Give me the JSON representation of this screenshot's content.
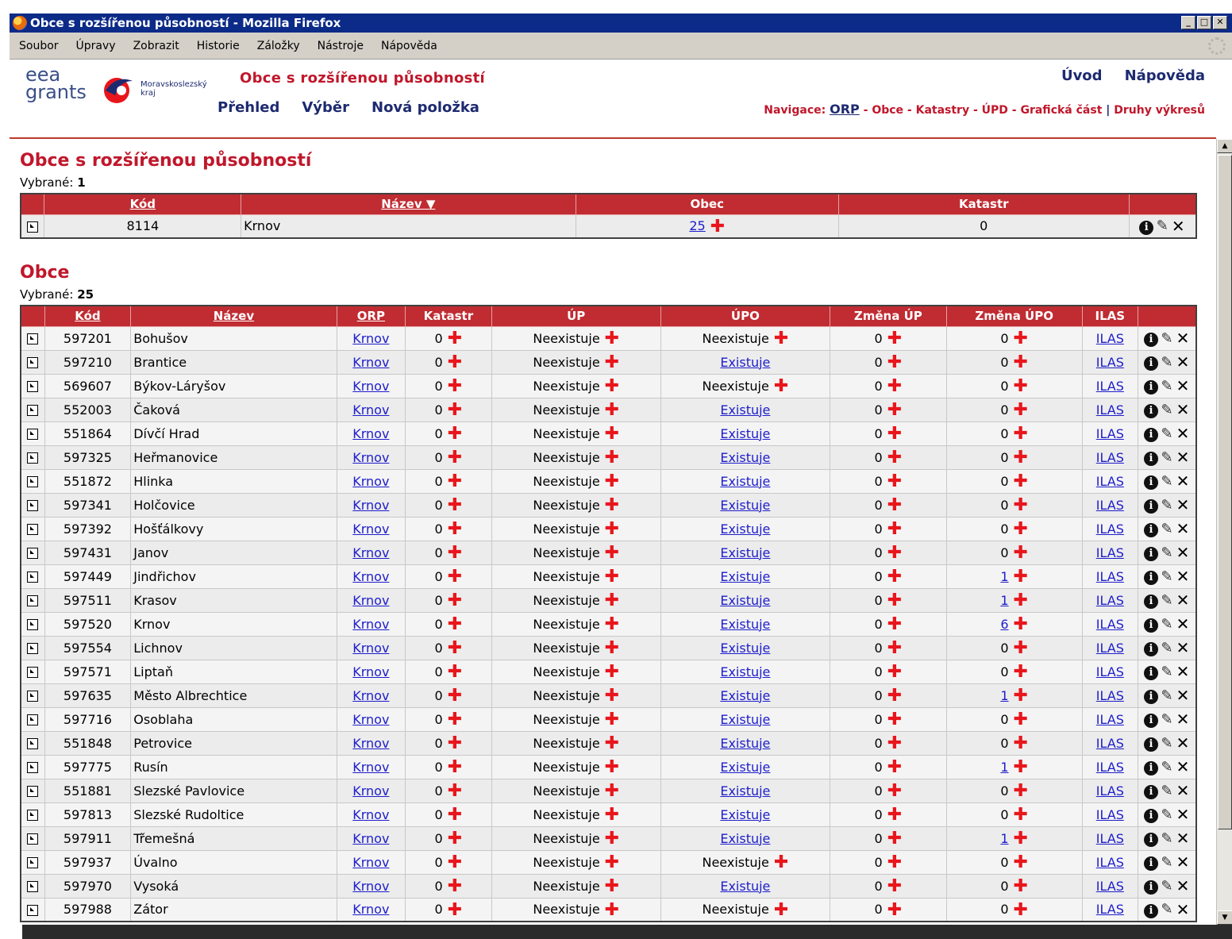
{
  "window": {
    "title": "Obce s rozšířenou působností - Mozilla Firefox"
  },
  "menu": [
    "Soubor",
    "Úpravy",
    "Zobrazit",
    "Historie",
    "Záložky",
    "Nástroje",
    "Nápověda"
  ],
  "header": {
    "logo_eea": "eea grants",
    "logo_msk": "Moravskoslezský kraj",
    "title": "Obce s rozšířenou působností",
    "nav": [
      "Přehled",
      "Výběr",
      "Nová položka"
    ],
    "links": [
      "Úvod",
      "Nápověda"
    ],
    "navigation_label": "Navigace:",
    "breadcrumb": [
      "ORP",
      "Obce",
      "Katastry",
      "ÚPD",
      "Grafická část",
      "Druhy výkresů"
    ]
  },
  "orp": {
    "heading": "Obce s rozšířenou působností",
    "selected_label": "Vybrané:",
    "selected_count": "1",
    "columns": [
      "Kód",
      "Název ▼",
      "Obec",
      "Katastr"
    ],
    "rows": [
      {
        "kod": "8114",
        "nazev": "Krnov",
        "obec": "25",
        "katastr": "0"
      }
    ]
  },
  "obce": {
    "heading": "Obce",
    "selected_label": "Vybrané:",
    "selected_count": "25",
    "columns": [
      "Kód",
      "Název",
      "ORP",
      "Katastr",
      "ÚP",
      "ÚPO",
      "Změna ÚP",
      "Změna ÚPO",
      "ILAS"
    ],
    "rows": [
      {
        "kod": "597201",
        "nazev": "Bohušov",
        "orp": "Krnov",
        "katastr": "0",
        "up": "Neexistuje",
        "upo": "Neexistuje",
        "upo_link": false,
        "zmena_up": "0",
        "zmena_upo": "0",
        "zmena_upo_link": false,
        "ilas": "ILAS"
      },
      {
        "kod": "597210",
        "nazev": "Brantice",
        "orp": "Krnov",
        "katastr": "0",
        "up": "Neexistuje",
        "upo": "Existuje",
        "upo_link": true,
        "zmena_up": "0",
        "zmena_upo": "0",
        "zmena_upo_link": false,
        "ilas": "ILAS"
      },
      {
        "kod": "569607",
        "nazev": "Býkov-Láryšov",
        "orp": "Krnov",
        "katastr": "0",
        "up": "Neexistuje",
        "upo": "Neexistuje",
        "upo_link": false,
        "zmena_up": "0",
        "zmena_upo": "0",
        "zmena_upo_link": false,
        "ilas": "ILAS"
      },
      {
        "kod": "552003",
        "nazev": "Čaková",
        "orp": "Krnov",
        "katastr": "0",
        "up": "Neexistuje",
        "upo": "Existuje",
        "upo_link": true,
        "zmena_up": "0",
        "zmena_upo": "0",
        "zmena_upo_link": false,
        "ilas": "ILAS"
      },
      {
        "kod": "551864",
        "nazev": "Dívčí Hrad",
        "orp": "Krnov",
        "katastr": "0",
        "up": "Neexistuje",
        "upo": "Existuje",
        "upo_link": true,
        "zmena_up": "0",
        "zmena_upo": "0",
        "zmena_upo_link": false,
        "ilas": "ILAS"
      },
      {
        "kod": "597325",
        "nazev": "Heřmanovice",
        "orp": "Krnov",
        "katastr": "0",
        "up": "Neexistuje",
        "upo": "Existuje",
        "upo_link": true,
        "zmena_up": "0",
        "zmena_upo": "0",
        "zmena_upo_link": false,
        "ilas": "ILAS"
      },
      {
        "kod": "551872",
        "nazev": "Hlinka",
        "orp": "Krnov",
        "katastr": "0",
        "up": "Neexistuje",
        "upo": "Existuje",
        "upo_link": true,
        "zmena_up": "0",
        "zmena_upo": "0",
        "zmena_upo_link": false,
        "ilas": "ILAS"
      },
      {
        "kod": "597341",
        "nazev": "Holčovice",
        "orp": "Krnov",
        "katastr": "0",
        "up": "Neexistuje",
        "upo": "Existuje",
        "upo_link": true,
        "zmena_up": "0",
        "zmena_upo": "0",
        "zmena_upo_link": false,
        "ilas": "ILAS"
      },
      {
        "kod": "597392",
        "nazev": "Hošťálkovy",
        "orp": "Krnov",
        "katastr": "0",
        "up": "Neexistuje",
        "upo": "Existuje",
        "upo_link": true,
        "zmena_up": "0",
        "zmena_upo": "0",
        "zmena_upo_link": false,
        "ilas": "ILAS"
      },
      {
        "kod": "597431",
        "nazev": "Janov",
        "orp": "Krnov",
        "katastr": "0",
        "up": "Neexistuje",
        "upo": "Existuje",
        "upo_link": true,
        "zmena_up": "0",
        "zmena_upo": "0",
        "zmena_upo_link": false,
        "ilas": "ILAS"
      },
      {
        "kod": "597449",
        "nazev": "Jindřichov",
        "orp": "Krnov",
        "katastr": "0",
        "up": "Neexistuje",
        "upo": "Existuje",
        "upo_link": true,
        "zmena_up": "0",
        "zmena_upo": "1",
        "zmena_upo_link": true,
        "ilas": "ILAS"
      },
      {
        "kod": "597511",
        "nazev": "Krasov",
        "orp": "Krnov",
        "katastr": "0",
        "up": "Neexistuje",
        "upo": "Existuje",
        "upo_link": true,
        "zmena_up": "0",
        "zmena_upo": "1",
        "zmena_upo_link": true,
        "ilas": "ILAS"
      },
      {
        "kod": "597520",
        "nazev": "Krnov",
        "orp": "Krnov",
        "katastr": "0",
        "up": "Neexistuje",
        "upo": "Existuje",
        "upo_link": true,
        "zmena_up": "0",
        "zmena_upo": "6",
        "zmena_upo_link": true,
        "ilas": "ILAS"
      },
      {
        "kod": "597554",
        "nazev": "Lichnov",
        "orp": "Krnov",
        "katastr": "0",
        "up": "Neexistuje",
        "upo": "Existuje",
        "upo_link": true,
        "zmena_up": "0",
        "zmena_upo": "0",
        "zmena_upo_link": false,
        "ilas": "ILAS"
      },
      {
        "kod": "597571",
        "nazev": "Liptaň",
        "orp": "Krnov",
        "katastr": "0",
        "up": "Neexistuje",
        "upo": "Existuje",
        "upo_link": true,
        "zmena_up": "0",
        "zmena_upo": "0",
        "zmena_upo_link": false,
        "ilas": "ILAS"
      },
      {
        "kod": "597635",
        "nazev": "Město Albrechtice",
        "orp": "Krnov",
        "katastr": "0",
        "up": "Neexistuje",
        "upo": "Existuje",
        "upo_link": true,
        "zmena_up": "0",
        "zmena_upo": "1",
        "zmena_upo_link": true,
        "ilas": "ILAS"
      },
      {
        "kod": "597716",
        "nazev": "Osoblaha",
        "orp": "Krnov",
        "katastr": "0",
        "up": "Neexistuje",
        "upo": "Existuje",
        "upo_link": true,
        "zmena_up": "0",
        "zmena_upo": "0",
        "zmena_upo_link": false,
        "ilas": "ILAS"
      },
      {
        "kod": "551848",
        "nazev": "Petrovice",
        "orp": "Krnov",
        "katastr": "0",
        "up": "Neexistuje",
        "upo": "Existuje",
        "upo_link": true,
        "zmena_up": "0",
        "zmena_upo": "0",
        "zmena_upo_link": false,
        "ilas": "ILAS"
      },
      {
        "kod": "597775",
        "nazev": "Rusín",
        "orp": "Krnov",
        "katastr": "0",
        "up": "Neexistuje",
        "upo": "Existuje",
        "upo_link": true,
        "zmena_up": "0",
        "zmena_upo": "1",
        "zmena_upo_link": true,
        "ilas": "ILAS"
      },
      {
        "kod": "551881",
        "nazev": "Slezské Pavlovice",
        "orp": "Krnov",
        "katastr": "0",
        "up": "Neexistuje",
        "upo": "Existuje",
        "upo_link": true,
        "zmena_up": "0",
        "zmena_upo": "0",
        "zmena_upo_link": false,
        "ilas": "ILAS"
      },
      {
        "kod": "597813",
        "nazev": "Slezské Rudoltice",
        "orp": "Krnov",
        "katastr": "0",
        "up": "Neexistuje",
        "upo": "Existuje",
        "upo_link": true,
        "zmena_up": "0",
        "zmena_upo": "0",
        "zmena_upo_link": false,
        "ilas": "ILAS"
      },
      {
        "kod": "597911",
        "nazev": "Třemešná",
        "orp": "Krnov",
        "katastr": "0",
        "up": "Neexistuje",
        "upo": "Existuje",
        "upo_link": true,
        "zmena_up": "0",
        "zmena_upo": "1",
        "zmena_upo_link": true,
        "ilas": "ILAS"
      },
      {
        "kod": "597937",
        "nazev": "Úvalno",
        "orp": "Krnov",
        "katastr": "0",
        "up": "Neexistuje",
        "upo": "Neexistuje",
        "upo_link": false,
        "zmena_up": "0",
        "zmena_upo": "0",
        "zmena_upo_link": false,
        "ilas": "ILAS"
      },
      {
        "kod": "597970",
        "nazev": "Vysoká",
        "orp": "Krnov",
        "katastr": "0",
        "up": "Neexistuje",
        "upo": "Existuje",
        "upo_link": true,
        "zmena_up": "0",
        "zmena_upo": "0",
        "zmena_upo_link": false,
        "ilas": "ILAS"
      },
      {
        "kod": "597988",
        "nazev": "Zátor",
        "orp": "Krnov",
        "katastr": "0",
        "up": "Neexistuje",
        "upo": "Neexistuje",
        "upo_link": false,
        "zmena_up": "0",
        "zmena_upo": "0",
        "zmena_upo_link": false,
        "ilas": "ILAS"
      }
    ]
  },
  "icons": {
    "open": "open-record-icon",
    "add": "add-plus-icon",
    "info": "info-icon",
    "edit": "pencil-icon",
    "delete": "close-x-icon"
  },
  "colors": {
    "accent": "#c02c32",
    "title_red": "#c0172b",
    "nav_blue": "#1d2a70",
    "titlebar": "#0c2a87"
  }
}
